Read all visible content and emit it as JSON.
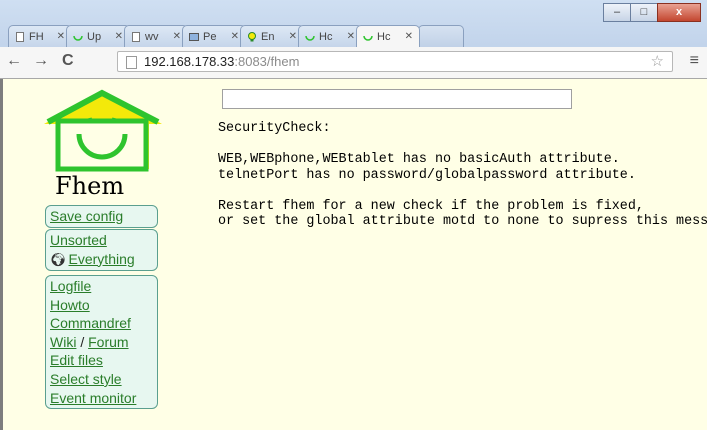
{
  "window": {
    "buttons": [
      "–",
      "□",
      "x"
    ]
  },
  "tabs": [
    {
      "label": "FH",
      "icon": "page-icon"
    },
    {
      "label": "Up",
      "icon": "smiley-icon"
    },
    {
      "label": "wv",
      "icon": "page-icon"
    },
    {
      "label": "Pe",
      "icon": "picture-icon"
    },
    {
      "label": "En",
      "icon": "bulb-icon"
    },
    {
      "label": "Hc",
      "icon": "smiley-icon"
    },
    {
      "label": "Hc",
      "icon": "smiley-icon",
      "active": true
    }
  ],
  "toolbar": {
    "back": "←",
    "forward": "→",
    "reload": "C",
    "url_host": "192.168.178.33",
    "url_rest": ":8083/fhem",
    "star": "☆",
    "menu": "≡"
  },
  "sidebar": {
    "logo_text": "Fhem",
    "save_config": "Save config",
    "rooms": [
      "Unsorted",
      "Everything"
    ],
    "links": {
      "logfile": "Logfile",
      "howto": "Howto",
      "commandref": "Commandref",
      "wiki": "Wiki",
      "separator": " / ",
      "forum": "Forum",
      "edit_files": "Edit files",
      "select_style": "Select style",
      "event_monitor": "Event monitor"
    }
  },
  "main": {
    "command_value": "",
    "message": "SecurityCheck:\n\nWEB,WEBphone,WEBtablet has no basicAuth attribute.\ntelnetPort has no password/globalpassword attribute.\n\nRestart fhem for a new check if the problem is fixed,\nor set the global attribute motd to none to supress this message."
  },
  "colors": {
    "page_bg": "#ffffe6",
    "link": "#2a7d2a",
    "logo_green": "#2ec42e",
    "logo_yellow": "#f3e90a"
  }
}
